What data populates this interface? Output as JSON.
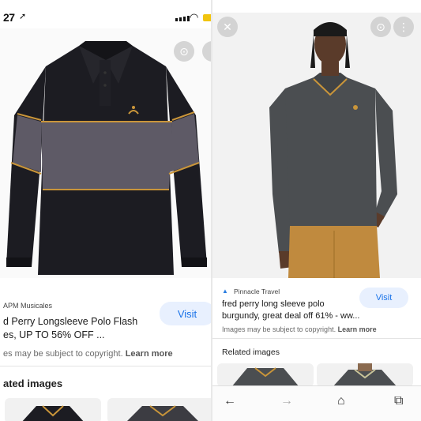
{
  "left": {
    "status": {
      "time": "27"
    },
    "result": {
      "source": "APM Musicales",
      "title_line1": "d Perry Longsleeve Polo Flash",
      "title_line2": "es, UP TO 56% OFF ...",
      "visit_label": "Visit",
      "copyright": "es may be subject to copyright.",
      "learn_more": "Learn more"
    },
    "related_label": "ated images"
  },
  "right": {
    "result": {
      "source": "Pinnacle Travel",
      "title_line1": "fred perry long sleeve polo",
      "title_line2": "burgundy, great deal off 61% - ww...",
      "visit_label": "Visit",
      "copyright": "Images may be subject to copyright.",
      "learn_more": "Learn more"
    },
    "related_label": "Related images",
    "toolbar_icons": [
      "back-arrow-icon",
      "forward-arrow-icon",
      "home-icon",
      "tabs-icon"
    ]
  },
  "colors": {
    "accent": "#1a73e8",
    "visit_bg": "#e8f0fe",
    "shirt_black": "#1c1c22",
    "shirt_grey": "#5e5a66",
    "tipping_gold": "#c9953a",
    "polo_charcoal": "#4b4e51",
    "chinos": "#c08a3e"
  }
}
